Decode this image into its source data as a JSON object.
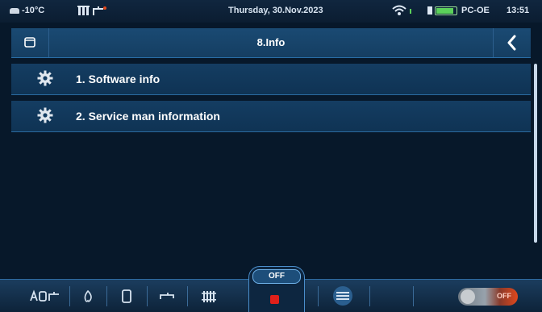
{
  "status_bar": {
    "outside_temp": "-10°C",
    "date": "Thursday, 30.Nov.2023",
    "device_name": "PC-OE",
    "time": "13:51"
  },
  "header": {
    "title": "8.Info",
    "left_icon": "folder-icon",
    "right_icon": "chevron-left-icon"
  },
  "menu": {
    "items": [
      {
        "label": "1.  Software info",
        "icon": "gear-icon"
      },
      {
        "label": "2. Service man information",
        "icon": "gear-icon"
      }
    ]
  },
  "bottom_nav": {
    "off_label": "OFF",
    "toggle_label": "OFF"
  },
  "colors": {
    "background": "#07182a",
    "accent_blue": "#2a6ea8",
    "stop_red": "#e0201a",
    "battery_green": "#5bd15a"
  }
}
